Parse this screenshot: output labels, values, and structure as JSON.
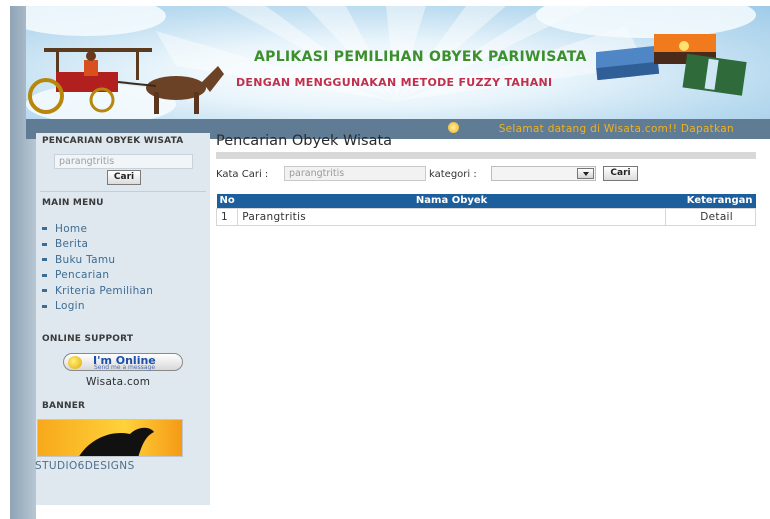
{
  "header": {
    "title": "APLIKASI PEMILIHAN OBYEK PARIWISATA",
    "subtitle": "DENGAN MENGGUNAKAN METODE FUZZY TAHANI",
    "welcome_text": "Selamat datang di Wisata.com!! Dapatkan"
  },
  "sidebar": {
    "search_heading": "PENCARIAN OBYEK WISATA",
    "search_value": "parangtritis",
    "search_button": "Cari",
    "menu_heading": "MAIN MENU",
    "menu_items": [
      {
        "label": "Home"
      },
      {
        "label": "Berita"
      },
      {
        "label": "Buku Tamu"
      },
      {
        "label": "Pencarian"
      },
      {
        "label": "Kriteria Pemilihan"
      },
      {
        "label": "Login"
      }
    ],
    "support_heading": "ONLINE SUPPORT",
    "ym_status": "I'm Online",
    "ym_sub": "Send me a message",
    "support_name": "Wisata.com",
    "banner_heading": "BANNER",
    "banner_caption": "STUDIO6DESIGNS"
  },
  "main": {
    "title": "Pencarian Obyek Wisata",
    "kata_cari_label": "Kata Cari :",
    "kata_cari_value": "parangtritis",
    "kategori_label": "kategori :",
    "kategori_value": "",
    "cari_button": "Cari",
    "table": {
      "columns": [
        "No",
        "Nama Obyek",
        "Keterangan"
      ],
      "rows": [
        {
          "no": "1",
          "nama": "Parangtritis",
          "keterangan": "Detail"
        }
      ]
    }
  },
  "colors": {
    "header_green": "#3d8f2e",
    "header_red": "#c0304c",
    "status_bar": "#607c95",
    "welcome": "#f0b21c",
    "table_header": "#1c5f9c",
    "menu_link": "#3d6c93"
  }
}
